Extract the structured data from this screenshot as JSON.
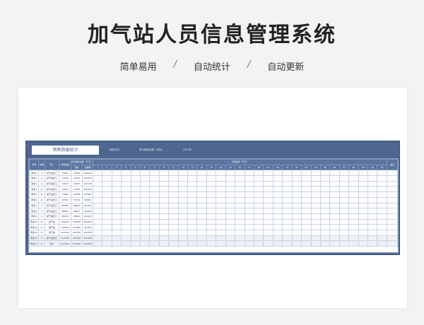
{
  "hero": {
    "title": "加气站人员信息管理系统",
    "features": [
      "简单易用",
      "自动统计",
      "自动更新"
    ],
    "separator": "/"
  },
  "sheet": {
    "title": "销售数据统计",
    "meta": [
      "选择月份",
      "单日销售总额（月份）",
      "2023年"
    ],
    "header_top": [
      "序号",
      "班组",
      "员工",
      "任务数量",
      "当月销售总额（千元）",
      "日销售额（千元）",
      "备注"
    ],
    "header_sub": [
      "目标",
      "完成率"
    ],
    "day_count": 31
  },
  "colors": {
    "frame": "#4e6690",
    "header": "#5b74a0",
    "grid_line": "#c9d2e2",
    "background": "#f3f3f4"
  },
  "rows": [
    {
      "no": "附表1",
      "group": "A",
      "name": "加气站员工",
      "target": "73000",
      "sales": "70536",
      "rate": "102012"
    },
    {
      "no": "附表2",
      "group": "A",
      "name": "加气站员工",
      "target": "73100",
      "sales": "72416",
      "rate": "101872"
    },
    {
      "no": "附表3",
      "group": "A",
      "name": "加气站员工",
      "target": "73672",
      "sales": "72467",
      "rate": "102146"
    },
    {
      "no": "附表4",
      "group": "B",
      "name": "加气站员工",
      "target": "72600",
      "sales": "72872",
      "rate": "102163"
    },
    {
      "no": "附表5",
      "group": "B",
      "name": "加气站员工",
      "target": "72800",
      "sales": "72838",
      "rate": "102461"
    },
    {
      "no": "附表6",
      "group": "B",
      "name": "加气站员工",
      "target": "72700",
      "sales": "72716",
      "rate": "98926"
    },
    {
      "no": "附表7",
      "group": "C",
      "name": "加气站员工",
      "target": "69800",
      "sales": "68497",
      "rate": "102457"
    },
    {
      "no": "附表8",
      "group": "C",
      "name": "加气站员工",
      "target": "48900",
      "sales": "48537",
      "rate": "102567"
    },
    {
      "no": "附表9",
      "group": "C",
      "name": "加气站员工",
      "target": "48900",
      "sales": "48890",
      "rate": "101837"
    },
    {
      "no": "附表10",
      "group": "D",
      "name": "加气站",
      "target": "226000",
      "sales": "228000",
      "rate": "102002"
    },
    {
      "no": "附表11",
      "group": "D",
      "name": "加气站",
      "target": "215000",
      "sales": "215850",
      "rate": "101957"
    },
    {
      "no": "附表12",
      "group": "D",
      "name": "加气站",
      "target": "207000",
      "sales": "207500",
      "rate": "102455"
    },
    {
      "no": "附表13",
      "group": "D",
      "name": "加气站合计",
      "target": "211000",
      "sales": "209790",
      "rate": "210390"
    },
    {
      "no": "附表14",
      "group": "D",
      "name": "合计",
      "target": "611500",
      "sales": "610200",
      "rate": "210309"
    }
  ]
}
